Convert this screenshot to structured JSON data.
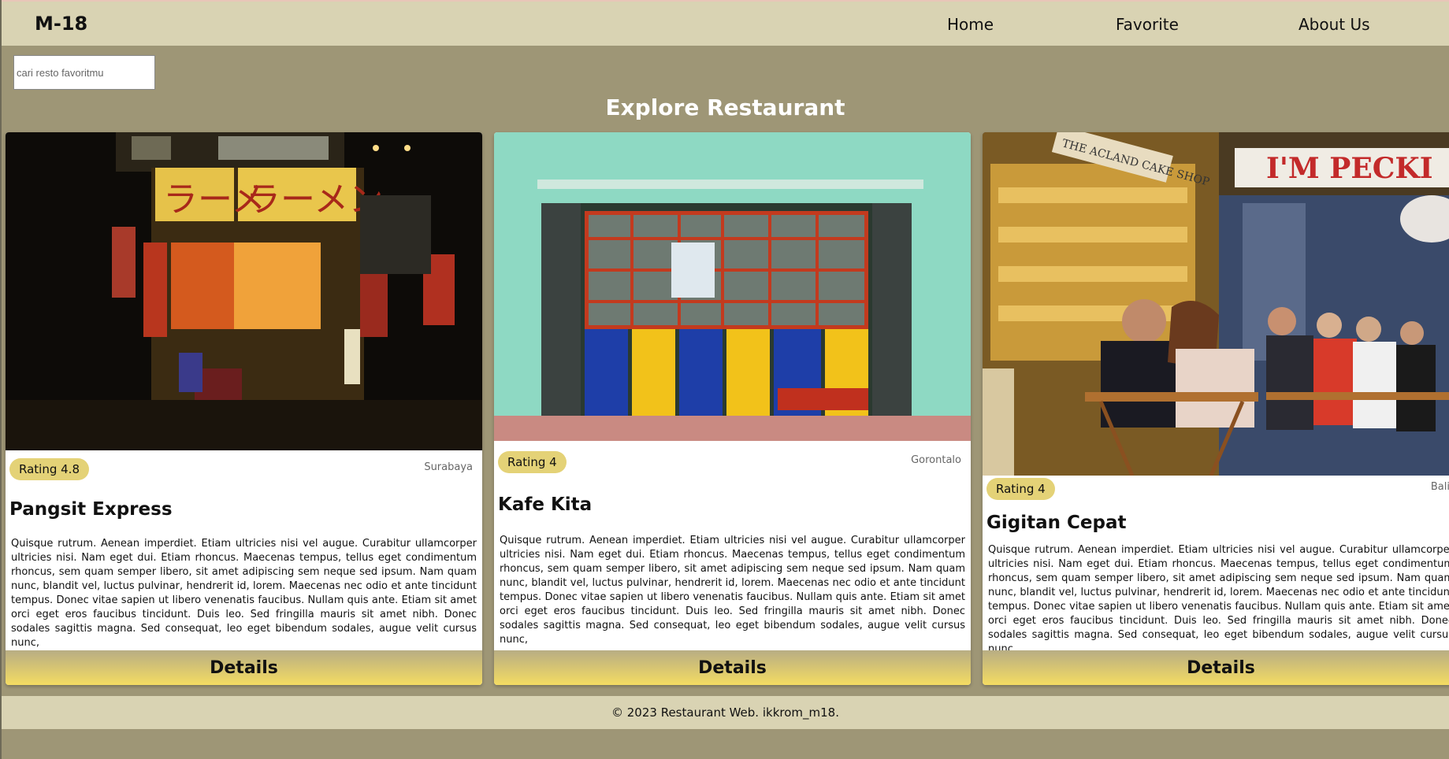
{
  "brand": "M-18",
  "nav": {
    "home": "Home",
    "favorite": "Favorite",
    "about": "About Us"
  },
  "search": {
    "placeholder": "cari resto favoritmu",
    "value": ""
  },
  "heading": "Explore Restaurant",
  "restaurants": [
    {
      "rating": "Rating 4.8",
      "city": "Surabaya",
      "name": "Pangsit Express",
      "description": "Quisque rutrum. Aenean imperdiet. Etiam ultricies nisi vel augue. Curabitur ullamcorper ultricies nisi. Nam eget dui. Etiam rhoncus. Maecenas tempus, tellus eget condimentum rhoncus, sem quam semper libero, sit amet adipiscing sem neque sed ipsum. Nam quam nunc, blandit vel, luctus pulvinar, hendrerit id, lorem. Maecenas nec odio et ante tincidunt tempus. Donec vitae sapien ut libero venenatis faucibus. Nullam quis ante. Etiam sit amet orci eget eros faucibus tincidunt. Duis leo. Sed fringilla mauris sit amet nibh. Donec sodales sagittis magna. Sed consequat, leo eget bibendum sodales, augue velit cursus nunc,",
      "details_label": "Details"
    },
    {
      "rating": "Rating 4",
      "city": "Gorontalo",
      "name": "Kafe Kita",
      "description": "Quisque rutrum. Aenean imperdiet. Etiam ultricies nisi vel augue. Curabitur ullamcorper ultricies nisi. Nam eget dui. Etiam rhoncus. Maecenas tempus, tellus eget condimentum rhoncus, sem quam semper libero, sit amet adipiscing sem neque sed ipsum. Nam quam nunc, blandit vel, luctus pulvinar, hendrerit id, lorem. Maecenas nec odio et ante tincidunt tempus. Donec vitae sapien ut libero venenatis faucibus. Nullam quis ante. Etiam sit amet orci eget eros faucibus tincidunt. Duis leo. Sed fringilla mauris sit amet nibh. Donec sodales sagittis magna. Sed consequat, leo eget bibendum sodales, augue velit cursus nunc,",
      "details_label": "Details"
    },
    {
      "rating": "Rating 4",
      "city": "Bali",
      "name": "Gigitan Cepat",
      "description": "Quisque rutrum. Aenean imperdiet. Etiam ultricies nisi vel augue. Curabitur ullamcorper ultricies nisi. Nam eget dui. Etiam rhoncus. Maecenas tempus, tellus eget condimentum rhoncus, sem quam semper libero, sit amet adipiscing sem neque sed ipsum. Nam quam nunc, blandit vel, luctus pulvinar, hendrerit id, lorem. Maecenas nec odio et ante tincidunt tempus. Donec vitae sapien ut libero venenatis faucibus. Nullam quis ante. Etiam sit amet orci eget eros faucibus tincidunt. Duis leo. Sed fringilla mauris sit amet nibh. Donec sodales sagittis magna. Sed consequat, leo eget bibendum sodales, augue velit cursus nunc,",
      "details_label": "Details"
    }
  ],
  "footer": "© 2023 Restaurant Web. ikkrom_m18.",
  "colors": {
    "header": "#d9d3b3",
    "page": "#9e9676",
    "badge": "#e4d277",
    "button": "#f4dc62"
  }
}
